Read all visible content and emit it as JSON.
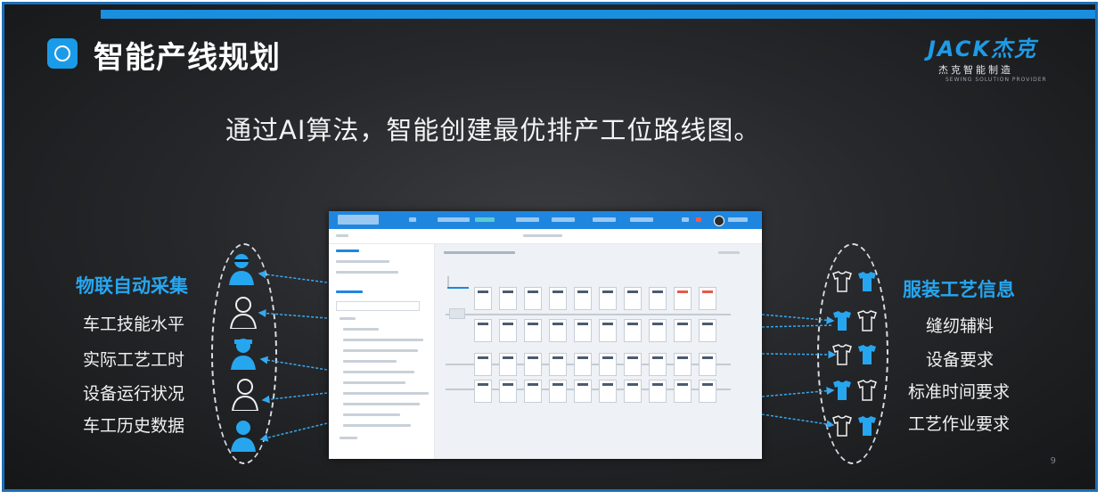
{
  "slide": {
    "title": "智能产线规划",
    "subtitle": "通过AI算法，智能创建最优排产工位路线图。",
    "page_number": "9"
  },
  "logo": {
    "brand": "JACK杰克",
    "sub": "杰克智能制造",
    "en": "SEWING SOLUTION PROVIDER"
  },
  "left_panel": {
    "heading": "物联自动采集",
    "items": [
      "车工技能水平",
      "实际工艺工时",
      "设备运行状况",
      "车工历史数据"
    ]
  },
  "right_panel": {
    "heading": "服装工艺信息",
    "items": [
      "缝纫辅料",
      "设备要求",
      "标准时间要求",
      "工艺作业要求"
    ]
  },
  "icons": {
    "title_icon": "ai-chip-icon",
    "left_icons": "worker-icon",
    "right_icons": "shirt-icon"
  },
  "colors": {
    "accent": "#27a6f0",
    "border": "#1a6fb8",
    "background": "#26282b"
  }
}
